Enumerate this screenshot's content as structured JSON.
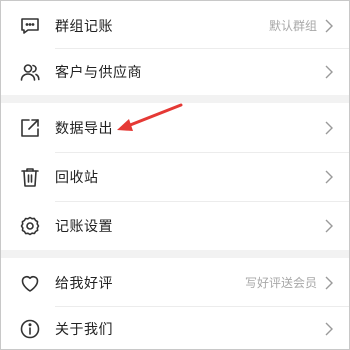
{
  "colors": {
    "background": "#f2f2f2",
    "card": "#ffffff",
    "text": "#222222",
    "hint": "#a8a8a8",
    "icon": "#333333",
    "annotation_arrow": "#e53935"
  },
  "menu": {
    "group_ledger": {
      "label": "群组记账",
      "hint": "默认群组",
      "icon": "chat-bubble-icon"
    },
    "customers": {
      "label": "客户与供应商",
      "icon": "users-icon"
    },
    "export": {
      "label": "数据导出",
      "icon": "export-icon"
    },
    "recycle": {
      "label": "回收站",
      "icon": "trash-icon"
    },
    "settings": {
      "label": "记账设置",
      "icon": "gear-icon"
    },
    "rate": {
      "label": "给我好评",
      "hint": "写好评送会员",
      "icon": "heart-icon"
    },
    "about": {
      "label": "关于我们",
      "icon": "info-icon"
    }
  }
}
